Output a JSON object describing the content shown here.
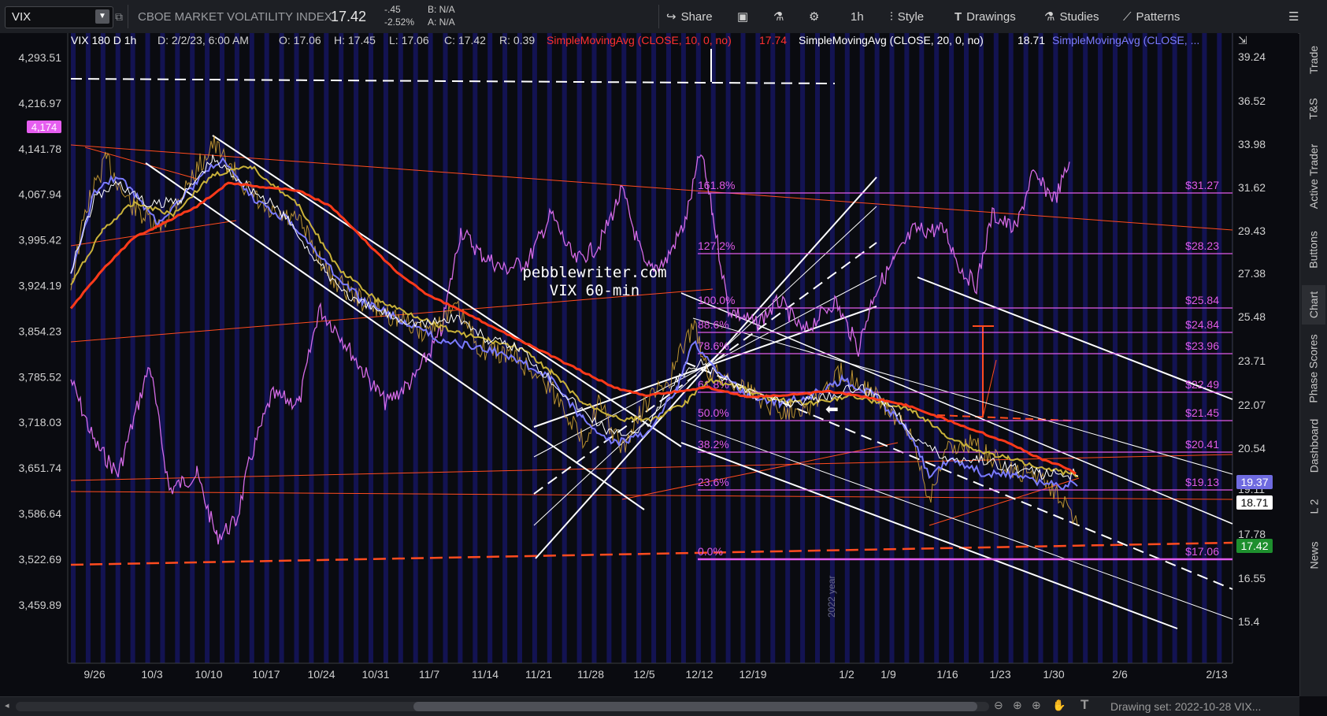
{
  "toolbar": {
    "symbol": "VIX",
    "company_name": "CBOE MARKET VOLATILITY INDEX",
    "price": "17.42",
    "change": "-.45",
    "change_pct": "-2.52%",
    "bid": "B: N/A",
    "ask": "A: N/A",
    "share_label": "Share",
    "timeframe_label": "1h",
    "style_label": "Style",
    "drawings_label": "Drawings",
    "studies_label": "Studies",
    "patterns_label": "Patterns"
  },
  "header": {
    "symbol_info": "VIX 180 D 1h",
    "date": "D: 2/2/23, 6:00 AM",
    "open": "O: 17.06",
    "high": "H: 17.45",
    "low": "L: 17.06",
    "close": "C: 17.42",
    "range": "R: 0.39",
    "sma10_label": "SimpleMovingAvg (CLOSE, 10, 0, no)",
    "sma10_value": "17.74",
    "sma20_label": "SimpleMovingAvg (CLOSE, 20, 0, no)",
    "sma20_value": "18.71",
    "sma_other_label": "SimpleMovingAvg (CLOSE, ..."
  },
  "left_axis": {
    "ticks": [
      "4,293.51",
      "4,216.97",
      "4,141.78",
      "4,067.94",
      "3,995.42",
      "3,924.19",
      "3,854.23",
      "3,785.52",
      "3,718.03",
      "3,651.74",
      "3,586.64",
      "3,522.69",
      "3,459.89"
    ],
    "highlight": "4,174"
  },
  "right_axis": {
    "ticks": [
      "39.24",
      "36.52",
      "33.98",
      "31.62",
      "29.43",
      "27.38",
      "25.48",
      "23.71",
      "22.07",
      "20.54",
      "19.11",
      "17.78",
      "16.55",
      "15.4"
    ],
    "badges": [
      {
        "label": "19.37",
        "color": "#6f6be0"
      },
      {
        "label": "18.71",
        "color": "#ffffff"
      },
      {
        "label": "17.42",
        "color": "#1e8f2e"
      }
    ]
  },
  "x_axis": {
    "labels": [
      "9/26",
      "10/3",
      "10/10",
      "10/17",
      "10/24",
      "10/31",
      "11/7",
      "11/14",
      "11/21",
      "11/28",
      "12/5",
      "12/12",
      "12/19",
      "1/2",
      "1/9",
      "1/16",
      "1/23",
      "1/30",
      "2/6",
      "2/13"
    ]
  },
  "fib": {
    "levels": [
      {
        "pct": "161.8%",
        "price": "$31.27"
      },
      {
        "pct": "127.2%",
        "price": "$28.23"
      },
      {
        "pct": "100.0%",
        "price": "$25.84"
      },
      {
        "pct": "88.6%",
        "price": "$24.84"
      },
      {
        "pct": "78.6%",
        "price": "$23.96"
      },
      {
        "pct": "61.8%",
        "price": "$22.49"
      },
      {
        "pct": "50.0%",
        "price": "$21.45"
      },
      {
        "pct": "38.2%",
        "price": "$20.41"
      },
      {
        "pct": "23.6%",
        "price": "$19.13"
      },
      {
        "pct": "0.0%",
        "price": "$17.06"
      }
    ]
  },
  "watermark": {
    "line1": "pebblewriter.com",
    "line2": "VIX 60-min"
  },
  "year_marker": "2022 year",
  "right_tabs": [
    "Trade",
    "T&S",
    "Active Trader",
    "Buttons",
    "Chart",
    "Phase Scores",
    "Dashboard",
    "L 2",
    "News"
  ],
  "bottom": {
    "drawing_set": "Drawing set: 2022-10-28 VIX..."
  },
  "colors": {
    "fib": "#e05bea",
    "sma10": "#ff2a2a",
    "sma20": "#ffffff",
    "sma_blue": "#7b7bff",
    "vix_line": "#d46ae6",
    "channel": "#ffffff",
    "trend_orange": "#ff4b1f",
    "background_band": "#14145a"
  }
}
